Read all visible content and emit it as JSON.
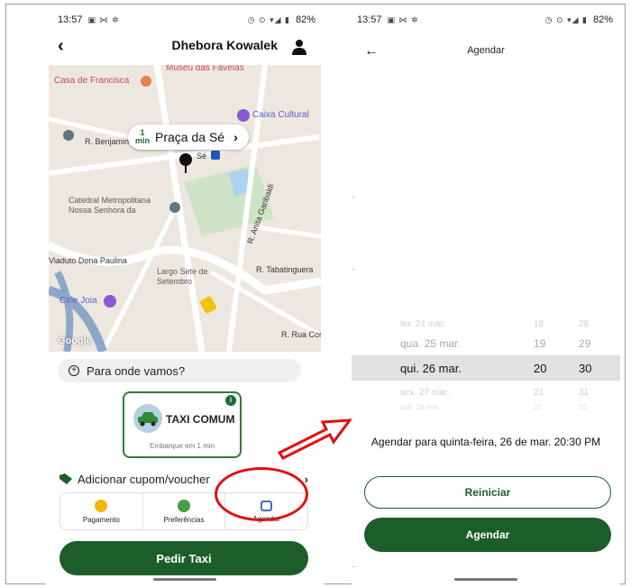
{
  "left_phone": {
    "status_time": "13:57",
    "status_battery": "82%",
    "user_name": "Dhebora Kowalek",
    "map": {
      "eta_value": "1",
      "eta_unit": "min",
      "location": "Praça da Sé",
      "poi_labels": [
        "Museu das Favelas",
        "Casa de Francisca",
        "Caixa Cultural",
        "Sé",
        "Catedral Metropolitana Nossa Senhora da",
        "Largo Sete de Setembro",
        "Cine Joia"
      ],
      "street_labels": [
        "R. Benjamin",
        "R. Anita Garibaldi",
        "R. Tabatinguera",
        "Viaduto Dona Paulina",
        "R. Rua Conde"
      ],
      "attribution": "Google"
    },
    "destination_placeholder": "Para onde vamos?",
    "taxi_option": {
      "title": "TAXI COMUM",
      "subtitle": "Embarque em 1 min"
    },
    "coupon_label": "Adicionar cupom/voucher",
    "options": [
      {
        "label": "Pagamento",
        "icon": "coin-icon",
        "color": "#f2b705"
      },
      {
        "label": "Preferências",
        "icon": "plus-circle-icon",
        "color": "#43a047"
      },
      {
        "label": "Agendar",
        "icon": "calendar-icon",
        "color": "#3f6fb5"
      }
    ],
    "primary_button": "Pedir Taxi"
  },
  "right_phone": {
    "status_time": "13:57",
    "status_battery": "82%",
    "title": "Agendar",
    "picker_rows": [
      {
        "date": "ter. 24 mar.",
        "hour": "18",
        "minute": "28"
      },
      {
        "date": "qua. 25 mar.",
        "hour": "19",
        "minute": "29"
      },
      {
        "date": "qui. 26 mar.",
        "hour": "20",
        "minute": "30"
      },
      {
        "date": "sex. 27 mar.",
        "hour": "21",
        "minute": "31"
      },
      {
        "date": "sáb. 28 mar.",
        "hour": "22",
        "minute": "32"
      }
    ],
    "summary": "Agendar para quinta-feira, 26 de mar. 20:30 PM",
    "reset_button": "Reiniciar",
    "confirm_button": "Agendar"
  },
  "colors": {
    "brand_green": "#1b5e2a",
    "callout_red": "#e01010"
  }
}
